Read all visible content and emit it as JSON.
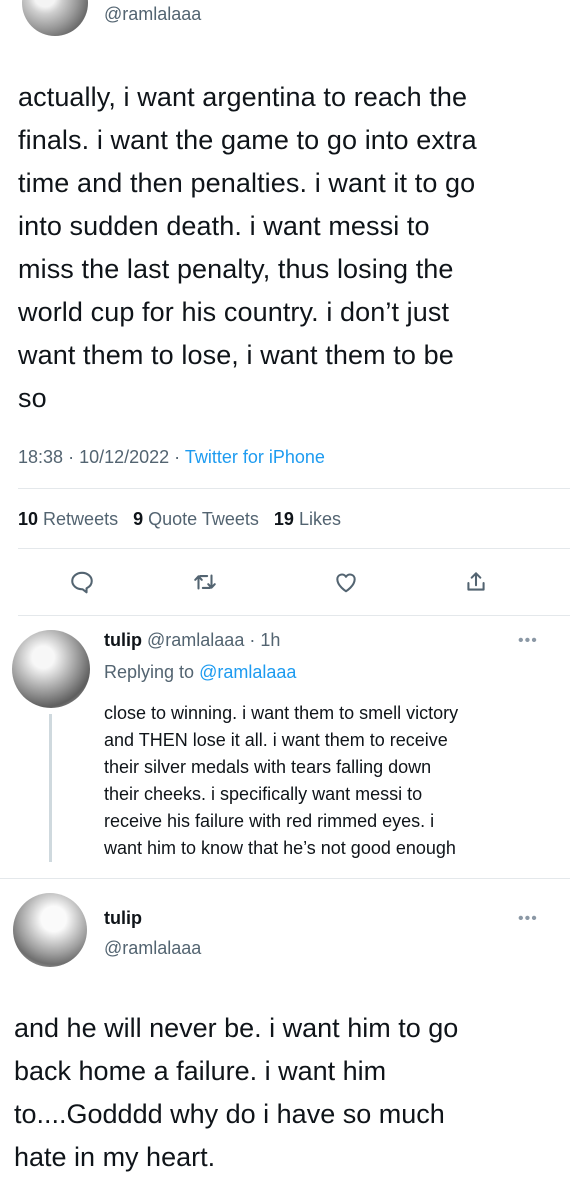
{
  "top_tweet": {
    "handle": "@ramlalaaa",
    "text_lines": [
      "actually, i want argentina to reach the",
      "finals. i want the game to go into extra",
      "time and then penalties. i want it to go",
      "into sudden death. i want messi to",
      "miss the last penalty, thus losing the",
      "world cup for his country. i don’t just",
      "want them to lose, i want them to be",
      "so"
    ],
    "time": "18:38",
    "date": "10/12/2022",
    "source": "Twitter for iPhone",
    "retweets_count": "10",
    "retweets_label": "Retweets",
    "quotes_count": "9",
    "quotes_label": "Quote Tweets",
    "likes_count": "19",
    "likes_label": "Likes",
    "actions": [
      "reply-icon",
      "retweet-icon",
      "like-icon",
      "share-icon"
    ]
  },
  "reply_tweet": {
    "name": "tulip",
    "handle": "@ramlalaaa",
    "age": "1h",
    "replying_label": "Replying to",
    "replying_to": "@ramlalaaa",
    "more_icon": "more-icon",
    "text_lines": [
      "close to winning. i want them to smell victory",
      "and THEN lose it all. i want them to receive",
      "their silver medals with tears falling down",
      "their cheeks. i specifically want messi to",
      "receive his failure with red rimmed eyes. i",
      "want him to know that he’s not good enough"
    ]
  },
  "bottom_tweet": {
    "name": "tulip",
    "handle": "@ramlalaaa",
    "more_icon": "more-icon",
    "text_lines": [
      "and he will never be. i want him to go",
      "back home a failure. i want him",
      "to....Godddd why do i have so much",
      "hate in my heart."
    ]
  },
  "colors": {
    "text": "#0f1419",
    "secondary": "#536471",
    "link": "#1d9bf0",
    "divider": "#e4e8eb",
    "thread_line": "#cfd9de"
  }
}
